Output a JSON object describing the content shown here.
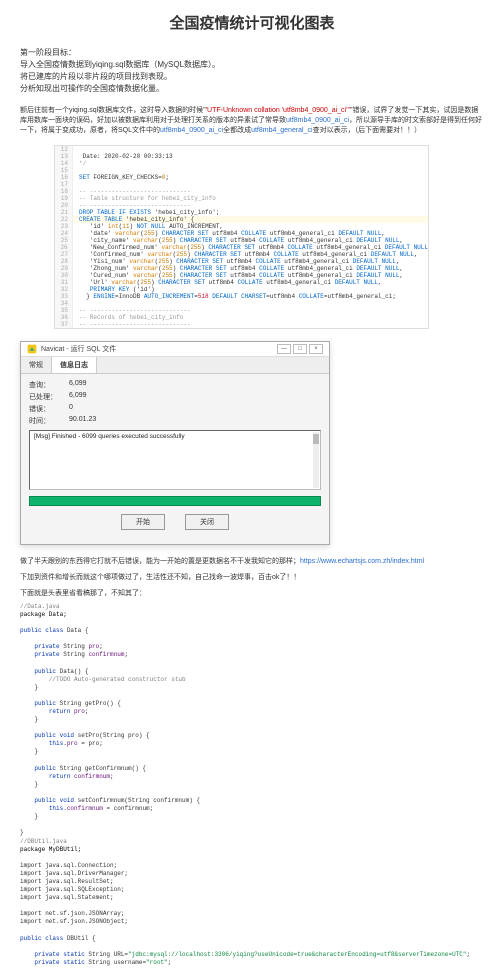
{
  "title": "全国疫情统计可视化图表",
  "intro_lines": [
    "第一阶段目标：",
    "导入全国疫情数据到yiqing.sql数据库（MySQL数据库）。",
    "将已建库的片段以非片段的项目找到表现。",
    "分析知现出可操作的全国疫情数据化量。"
  ],
  "para2_prefix": "额后往前有一个yiqing.sql数据库文件，这时导入数据的时候",
  "para2_err": "'UTF-Unknown collation 'utf8mb4_0900_ai_ci'\"",
  "para2_mid": "错误，试界了发觉一下其实，试因是数据库用数库一面块的误码，好加以被数据库利用对于处理打关系的版本的异素试了常导致",
  "para2_link1": "utf8mb4_0900_ai_ci",
  "para2_mid2": "，所以源导手库的时文索部好是得到任何好一下，将属于变成功，原者，将SQL文件中的",
  "para2_link2": "utf8mb4_0900_ai_ci",
  "para2_mid3": "全都改成",
  "para2_link3": "utf8mb4_general_ci",
  "para2_end": "查对以表示，（后下面需要对！！）",
  "code_date_comment": "Date: 2020-02-20 00:33:13",
  "code": {
    "lines": [
      {
        "n": "12",
        "t": [
          {
            "cls": "",
            "txt": ""
          }
        ]
      },
      {
        "n": "13",
        "t": [
          {
            "cls": "",
            "txt": " Date: 2020-02-20 00:33:13"
          }
        ]
      },
      {
        "n": "14",
        "t": [
          {
            "cls": "kw-grey",
            "txt": "*/"
          }
        ]
      },
      {
        "n": "15",
        "t": [
          {
            "cls": "",
            "txt": ""
          }
        ]
      },
      {
        "n": "16",
        "t": [
          {
            "cls": "kw-blue",
            "txt": "SET"
          },
          {
            "cls": "",
            "txt": " FOREIGN_KEY_CHECKS="
          },
          {
            "cls": "num",
            "txt": "0"
          },
          {
            "cls": "",
            "txt": ";"
          }
        ]
      },
      {
        "n": "17",
        "t": [
          {
            "cls": "",
            "txt": ""
          }
        ]
      },
      {
        "n": "18",
        "t": [
          {
            "cls": "kw-grey",
            "txt": "-- ----------------------------"
          }
        ]
      },
      {
        "n": "19",
        "t": [
          {
            "cls": "kw-grey",
            "txt": "-- Table structure for hebei_city_info"
          }
        ]
      },
      {
        "n": "20",
        "t": [
          {
            "cls": "kw-grey",
            "txt": "-- ----------------------------"
          }
        ]
      },
      {
        "n": "21",
        "t": [
          {
            "cls": "kw-blue",
            "txt": "DROP TABLE IF EXISTS"
          },
          {
            "cls": "",
            "txt": " 'hebei_city_info';"
          }
        ]
      },
      {
        "n": "22",
        "hl": true,
        "t": [
          {
            "cls": "kw-blue",
            "txt": "CREATE TABLE"
          },
          {
            "cls": "",
            "txt": " 'hebei_city_info' {"
          }
        ]
      },
      {
        "n": "23",
        "t": [
          {
            "cls": "",
            "txt": "   "
          },
          {
            "cls": "",
            "txt": "'id' "
          },
          {
            "cls": "kw-orange",
            "txt": "int"
          },
          {
            "cls": "",
            "txt": "("
          },
          {
            "cls": "num",
            "txt": "11"
          },
          {
            "cls": "",
            "txt": ") "
          },
          {
            "cls": "kw-blue",
            "txt": "NOT NULL"
          },
          {
            "cls": "",
            "txt": " AUTO_INCREMENT,"
          }
        ]
      },
      {
        "n": "24",
        "t": [
          {
            "cls": "",
            "txt": "   'date' "
          },
          {
            "cls": "kw-orange",
            "txt": "varchar"
          },
          {
            "cls": "",
            "txt": "("
          },
          {
            "cls": "num",
            "txt": "255"
          },
          {
            "cls": "",
            "txt": ") "
          },
          {
            "cls": "kw-blue",
            "txt": "CHARACTER SET"
          },
          {
            "cls": "",
            "txt": " utf8mb4 "
          },
          {
            "cls": "kw-blue",
            "txt": "COLLATE"
          },
          {
            "cls": "",
            "txt": " utf8mb4_general_ci "
          },
          {
            "cls": "kw-blue",
            "txt": "DEFAULT NULL"
          },
          {
            "cls": "",
            "txt": ","
          }
        ]
      },
      {
        "n": "25",
        "t": [
          {
            "cls": "",
            "txt": "   'city_name' "
          },
          {
            "cls": "kw-orange",
            "txt": "varchar"
          },
          {
            "cls": "",
            "txt": "("
          },
          {
            "cls": "num",
            "txt": "255"
          },
          {
            "cls": "",
            "txt": ") "
          },
          {
            "cls": "kw-blue",
            "txt": "CHARACTER SET"
          },
          {
            "cls": "",
            "txt": " utf8mb4 "
          },
          {
            "cls": "kw-blue",
            "txt": "COLLATE"
          },
          {
            "cls": "",
            "txt": " utf8mb4_general_ci "
          },
          {
            "cls": "kw-blue",
            "txt": "DEFAULT NULL"
          },
          {
            "cls": "",
            "txt": ","
          }
        ]
      },
      {
        "n": "26",
        "t": [
          {
            "cls": "",
            "txt": "   'New_Confirmed_num' "
          },
          {
            "cls": "kw-orange",
            "txt": "varchar"
          },
          {
            "cls": "",
            "txt": "("
          },
          {
            "cls": "num",
            "txt": "255"
          },
          {
            "cls": "",
            "txt": ") "
          },
          {
            "cls": "kw-blue",
            "txt": "CHARACTER SET"
          },
          {
            "cls": "",
            "txt": " utf8mb4 "
          },
          {
            "cls": "kw-blue",
            "txt": "COLLATE"
          },
          {
            "cls": "",
            "txt": " utf8mb4_general_ci "
          },
          {
            "cls": "kw-blue",
            "txt": "DEFAULT NULL"
          }
        ]
      },
      {
        "n": "27",
        "t": [
          {
            "cls": "",
            "txt": "   'Confirmed_num' "
          },
          {
            "cls": "kw-orange",
            "txt": "varchar"
          },
          {
            "cls": "",
            "txt": "("
          },
          {
            "cls": "num",
            "txt": "255"
          },
          {
            "cls": "",
            "txt": ") "
          },
          {
            "cls": "kw-blue",
            "txt": "CHARACTER SET"
          },
          {
            "cls": "",
            "txt": " utf8mb4 "
          },
          {
            "cls": "kw-blue",
            "txt": "COLLATE"
          },
          {
            "cls": "",
            "txt": " utf8mb4_general_ci "
          },
          {
            "cls": "kw-blue",
            "txt": "DEFAULT NULL"
          },
          {
            "cls": "",
            "txt": ","
          }
        ]
      },
      {
        "n": "28",
        "t": [
          {
            "cls": "",
            "txt": "   'Yisi_num' "
          },
          {
            "cls": "kw-orange",
            "txt": "varchar"
          },
          {
            "cls": "",
            "txt": "("
          },
          {
            "cls": "num",
            "txt": "255"
          },
          {
            "cls": "",
            "txt": ") "
          },
          {
            "cls": "kw-blue",
            "txt": "CHARACTER SET"
          },
          {
            "cls": "",
            "txt": " utf8mb4 "
          },
          {
            "cls": "kw-blue",
            "txt": "COLLATE"
          },
          {
            "cls": "",
            "txt": " utf8mb4_general_ci "
          },
          {
            "cls": "kw-blue",
            "txt": "DEFAULT NULL"
          },
          {
            "cls": "",
            "txt": ","
          }
        ]
      },
      {
        "n": "29",
        "t": [
          {
            "cls": "",
            "txt": "   'Zhong_num' "
          },
          {
            "cls": "kw-orange",
            "txt": "varchar"
          },
          {
            "cls": "",
            "txt": "("
          },
          {
            "cls": "num",
            "txt": "255"
          },
          {
            "cls": "",
            "txt": ") "
          },
          {
            "cls": "kw-blue",
            "txt": "CHARACTER SET"
          },
          {
            "cls": "",
            "txt": " utf8mb4 "
          },
          {
            "cls": "kw-blue",
            "txt": "COLLATE"
          },
          {
            "cls": "",
            "txt": " utf8mb4_general_ci "
          },
          {
            "cls": "kw-blue",
            "txt": "DEFAULT NULL"
          },
          {
            "cls": "",
            "txt": ","
          }
        ]
      },
      {
        "n": "30",
        "t": [
          {
            "cls": "",
            "txt": "   'Cured_num' "
          },
          {
            "cls": "kw-orange",
            "txt": "varchar"
          },
          {
            "cls": "",
            "txt": "("
          },
          {
            "cls": "num",
            "txt": "255"
          },
          {
            "cls": "",
            "txt": ") "
          },
          {
            "cls": "kw-blue",
            "txt": "CHARACTER SET"
          },
          {
            "cls": "",
            "txt": " utf8mb4 "
          },
          {
            "cls": "kw-blue",
            "txt": "COLLATE"
          },
          {
            "cls": "",
            "txt": " utf8mb4_general_ci "
          },
          {
            "cls": "kw-blue",
            "txt": "DEFAULT NULL"
          },
          {
            "cls": "",
            "txt": ","
          }
        ]
      },
      {
        "n": "31",
        "t": [
          {
            "cls": "",
            "txt": "   'Url' "
          },
          {
            "cls": "kw-orange",
            "txt": "varchar"
          },
          {
            "cls": "",
            "txt": "("
          },
          {
            "cls": "num",
            "txt": "255"
          },
          {
            "cls": "",
            "txt": ") "
          },
          {
            "cls": "kw-blue",
            "txt": "CHARACTER SET"
          },
          {
            "cls": "",
            "txt": " utf8mb4 "
          },
          {
            "cls": "kw-blue",
            "txt": "COLLATE"
          },
          {
            "cls": "",
            "txt": " utf8mb4_general_ci "
          },
          {
            "cls": "kw-blue",
            "txt": "DEFAULT NULL"
          },
          {
            "cls": "",
            "txt": ","
          }
        ]
      },
      {
        "n": "32",
        "t": [
          {
            "cls": "",
            "txt": "   "
          },
          {
            "cls": "kw-blue",
            "txt": "PRIMARY KEY"
          },
          {
            "cls": "",
            "txt": " ('id')"
          }
        ]
      },
      {
        "n": "33",
        "t": [
          {
            "cls": "",
            "txt": "  } "
          },
          {
            "cls": "kw-blue",
            "txt": "ENGINE"
          },
          {
            "cls": "",
            "txt": "=InnoDB "
          },
          {
            "cls": "kw-blue",
            "txt": "AUTO_INCREMENT"
          },
          {
            "cls": "",
            "txt": "="
          },
          {
            "cls": "kw-red",
            "txt": "518"
          },
          {
            "cls": "",
            "txt": " "
          },
          {
            "cls": "kw-blue",
            "txt": "DEFAULT CHARSET"
          },
          {
            "cls": "",
            "txt": "=utf8mb4 "
          },
          {
            "cls": "kw-blue",
            "txt": "COLLATE"
          },
          {
            "cls": "",
            "txt": "=utf8mb4_general_ci;"
          }
        ]
      },
      {
        "n": "34",
        "t": [
          {
            "cls": "",
            "txt": ""
          }
        ]
      },
      {
        "n": "35",
        "t": [
          {
            "cls": "kw-grey",
            "txt": "-- ----------------------------"
          }
        ]
      },
      {
        "n": "36",
        "t": [
          {
            "cls": "kw-grey",
            "txt": "-- Records of hebei_city_info"
          }
        ]
      },
      {
        "n": "37",
        "t": [
          {
            "cls": "kw-grey",
            "txt": "-- ----------------------------"
          }
        ]
      }
    ]
  },
  "dialog": {
    "icon": "navicat-icon",
    "title": "Navicat - 运行 SQL 文件",
    "min": "—",
    "max": "□",
    "close": "×",
    "tabs": [
      "常规",
      "信息日志"
    ],
    "active_tab": 1,
    "rows": [
      {
        "label": "查询：",
        "value": "6,099"
      },
      {
        "label": "已处理：",
        "value": "6,099"
      },
      {
        "label": "错误：",
        "value": "0"
      },
      {
        "label": "时间：",
        "value": "90.01.23"
      }
    ],
    "log_text": "[Msg] Finished - 6099 queries executed successfully",
    "btn_start": "开始",
    "btn_close": "关闭"
  },
  "para3_a": "做了半天跟别的东西得它打就不后错误，能为一开始的置是更数据名不干发我知它的那样；",
  "para3_url": "https://www.echartsjs.com.zh/index.html",
  "para4": "下加到资件和增长而就这个哪项做过了，生活性还不知，自己找命一波焊事，百击ok了！！",
  "para5": "下面就是头表里省看稿那了，不知其了：",
  "java_data_comment": "//Data.java",
  "java_data_pkg": "package Data;",
  "java_data_class_decl": "public class Data {",
  "java_data_fields": [
    "private String pro;",
    "private String confirmnum;"
  ],
  "java_data_ctor": [
    "public Data() {",
    "//TODO Auto-generated constructor stub",
    "}"
  ],
  "java_data_getpro": [
    "public String getPro() {",
    "return pro;",
    "}"
  ],
  "java_data_setpro": [
    "public void setPro(String pro) {",
    "this.pro = pro;",
    "}"
  ],
  "java_data_getconf": [
    "public String getConfirmnum() {",
    "return confirmnum;",
    "}"
  ],
  "java_data_setconf": [
    "public void setConfirmnum(String confirmnum) {",
    "this.confirmnum = confirmnum;",
    "}"
  ],
  "java_dbutil_comment": "//DBUtil.java",
  "java_dbutil_pkg": "package MyDBUtil;",
  "java_dbutil_imports": [
    "import java.sql.Connection;",
    "import java.sql.DriverManager;",
    "import java.sql.ResultSet;",
    "import java.sql.SQLException;",
    "import java.sql.Statement;",
    "",
    "import net.sf.json.JSONArray;",
    "import net.sf.json.JSONObject;"
  ],
  "java_dbutil_class": "public class DBUtil {",
  "java_dbutil_url_pre": "private static String URL=",
  "java_dbutil_url_str": "\"jdbc:mysql://localhost:3306/yiqing?useUnicode=true&characterEncoding=utf8&serverTimezone=UTC\"",
  "java_dbutil_user_pre": "private static String username=",
  "java_dbutil_user_str": "\"root\""
}
